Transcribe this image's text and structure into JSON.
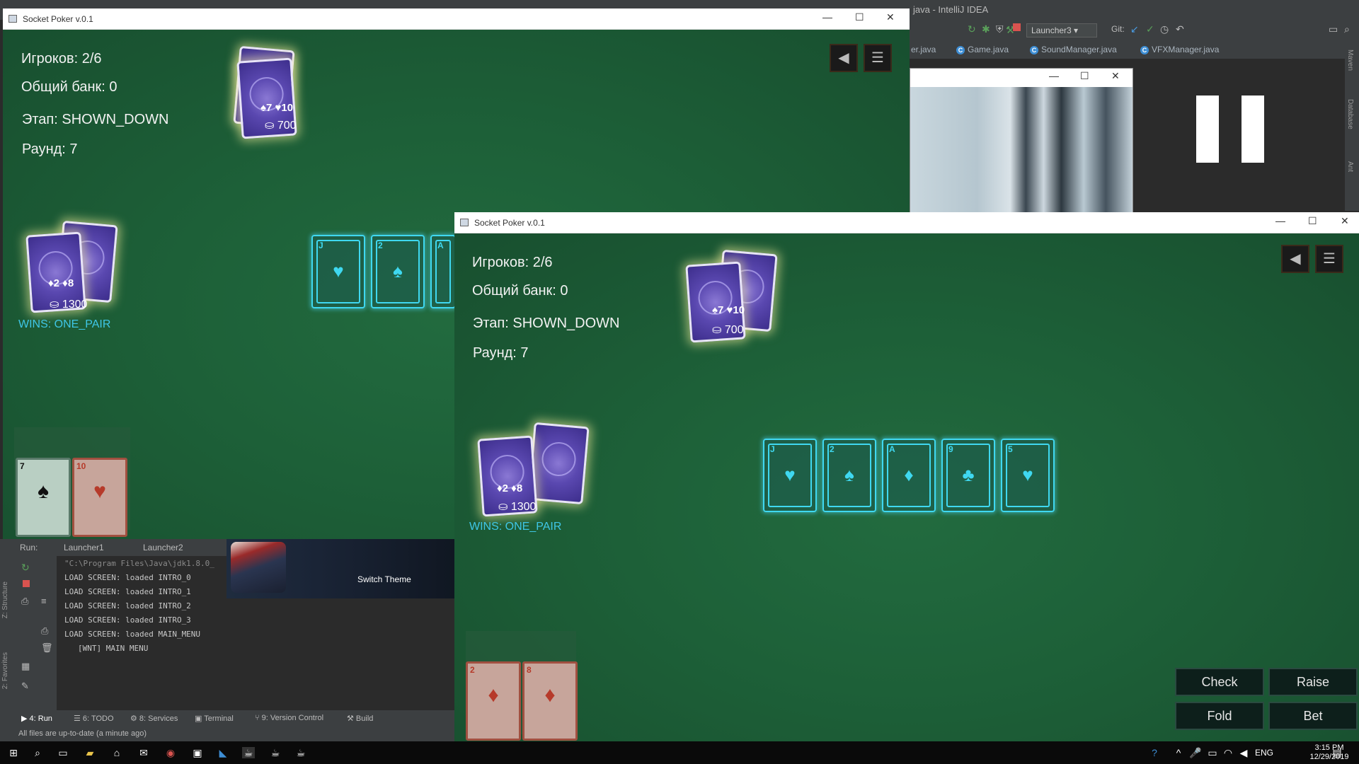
{
  "ide": {
    "title": "java - IntelliJ IDEA",
    "run_config": "Launcher3",
    "git_label": "Git:",
    "tabs": [
      "er.java",
      "Game.java",
      "SoundManager.java",
      "VFXManager.java"
    ],
    "right_tabs": [
      "Maven",
      "Database",
      "Ant"
    ],
    "run_label": "Run:",
    "run_tabs": [
      "Launcher1",
      "Launcher2"
    ],
    "log_lines": [
      "\"C:\\Program Files\\Java\\jdk1.8.0_",
      "LOAD SCREEN: loaded INTRO_0",
      "LOAD SCREEN: loaded INTRO_1",
      "LOAD SCREEN: loaded INTRO_2",
      "LOAD SCREEN: loaded INTRO_3",
      "LOAD SCREEN: loaded MAIN_MENU",
      "[WNT] MAIN MENU"
    ],
    "switch_theme": "Switch Theme",
    "bottom_tabs": [
      "4: Run",
      "6: TODO",
      "8: Services",
      "Terminal",
      "9: Version Control",
      "Build"
    ],
    "status": "All files are up-to-date (a minute ago)",
    "left_tabs": [
      "Z: Structure",
      "2: Favorites"
    ]
  },
  "window1": {
    "title": "Socket Poker v.0.1",
    "players": "Игроков: 2/6",
    "bank": "Общий банк: 0",
    "stage": "Этап: SHOWN_DOWN",
    "round": "Раунд: 7",
    "opponent_cards": "♠7 ♥10",
    "opponent_chips": "700",
    "player_cards": "♦2 ♦8",
    "player_chips": "1300",
    "wins": "WINS: ONE_PAIR",
    "community": [
      {
        "rank": "J",
        "suit": "♥"
      },
      {
        "rank": "2",
        "suit": "♠"
      },
      {
        "rank": "A",
        "suit": "♦"
      }
    ],
    "hand": [
      {
        "rank": "7",
        "suit": "♠",
        "color": "#111"
      },
      {
        "rank": "10",
        "suit": "♥",
        "color": "#b63a2a"
      }
    ]
  },
  "window2": {
    "title": "Socket Poker v.0.1",
    "players": "Игроков: 2/6",
    "bank": "Общий банк: 0",
    "stage": "Этап: SHOWN_DOWN",
    "round": "Раунд: 7",
    "opponent_cards": "♠7 ♥10",
    "opponent_chips": "700",
    "player_cards": "♦2 ♦8",
    "player_chips": "1300",
    "wins": "WINS: ONE_PAIR",
    "community": [
      {
        "rank": "J",
        "suit": "♥"
      },
      {
        "rank": "2",
        "suit": "♠"
      },
      {
        "rank": "A",
        "suit": "♦"
      },
      {
        "rank": "9",
        "suit": "♣"
      },
      {
        "rank": "5",
        "suit": "♥"
      }
    ],
    "hand": [
      {
        "rank": "2",
        "suit": "♦",
        "color": "#b63a2a"
      },
      {
        "rank": "8",
        "suit": "♦",
        "color": "#b63a2a"
      }
    ],
    "buttons": {
      "check": "Check",
      "raise": "Raise",
      "fold": "Fold",
      "bet": "Bet"
    }
  },
  "taskbar": {
    "lang": "ENG",
    "time": "3:15 PM",
    "date": "12/29/2019"
  }
}
